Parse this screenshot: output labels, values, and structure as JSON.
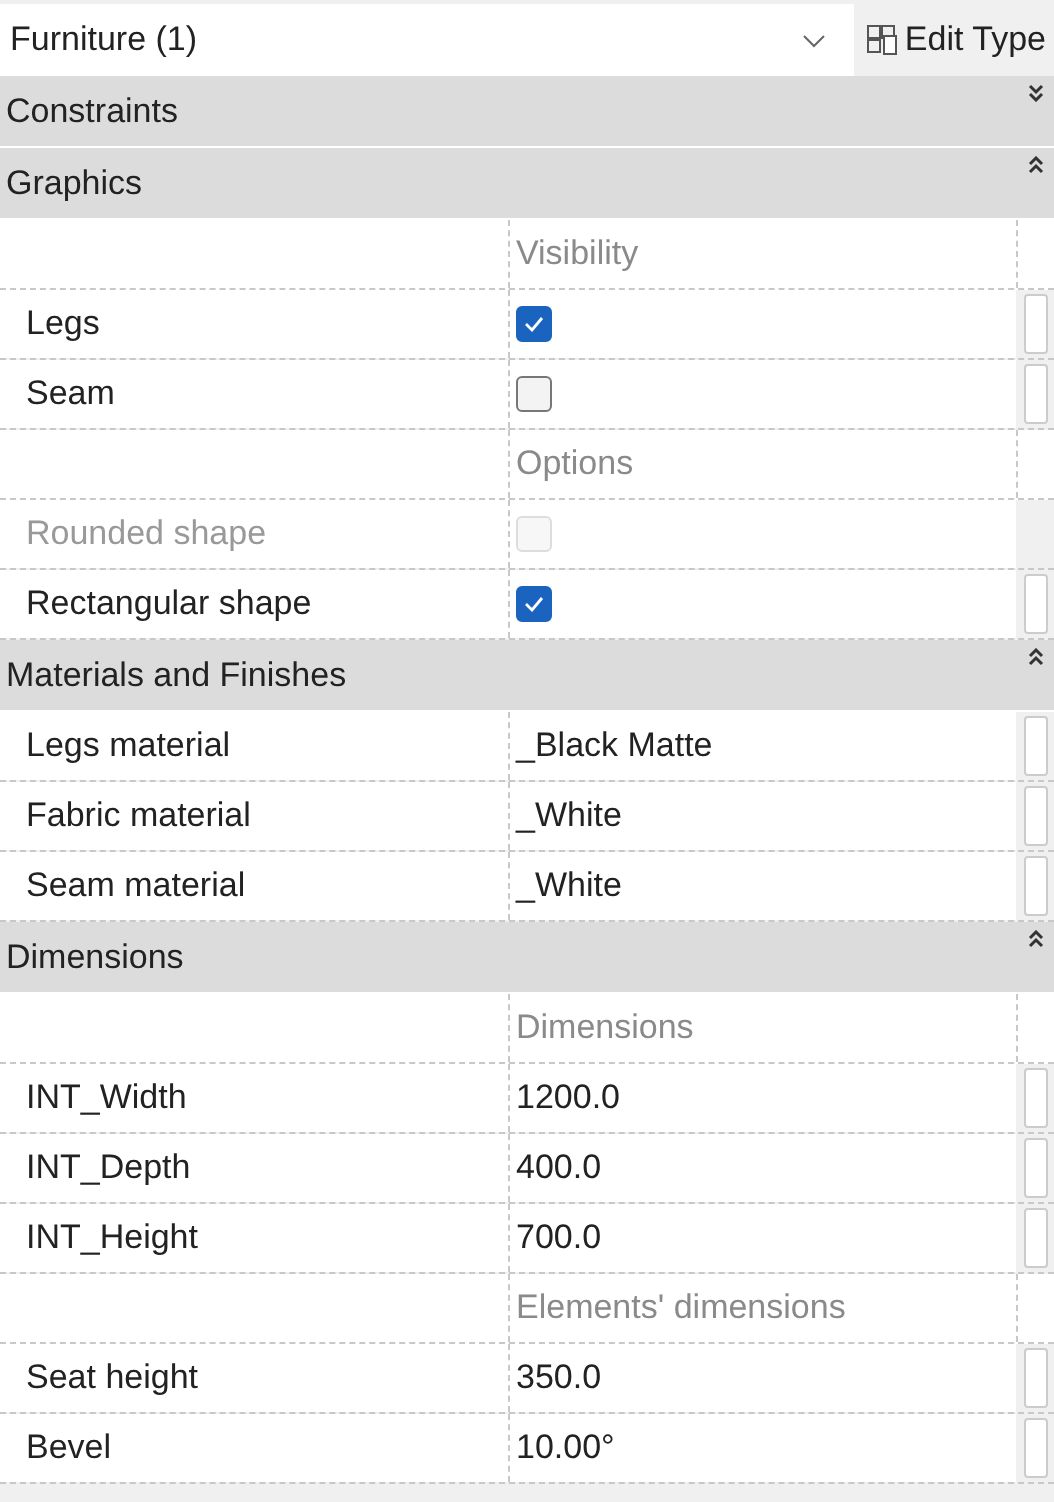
{
  "type_selector": {
    "value": "Furniture (1)"
  },
  "edit_type_button": {
    "label": "Edit Type"
  },
  "sections": [
    {
      "title": "Constraints",
      "expanded": false
    },
    {
      "title": "Graphics",
      "expanded": true,
      "rows": [
        {
          "kind": "group",
          "label": "Visibility"
        },
        {
          "kind": "check",
          "label": "Legs",
          "checked": true,
          "disabled": false
        },
        {
          "kind": "check",
          "label": "Seam",
          "checked": false,
          "disabled": false
        },
        {
          "kind": "group",
          "label": "Options"
        },
        {
          "kind": "check",
          "label": "Rounded shape",
          "checked": false,
          "disabled": true
        },
        {
          "kind": "check",
          "label": "Rectangular shape",
          "checked": true,
          "disabled": false
        }
      ]
    },
    {
      "title": "Materials and Finishes",
      "expanded": true,
      "rows": [
        {
          "kind": "text",
          "label": "Legs material",
          "value": "_Black Matte"
        },
        {
          "kind": "text",
          "label": "Fabric material",
          "value": "_White"
        },
        {
          "kind": "text",
          "label": "Seam material",
          "value": "_White"
        }
      ]
    },
    {
      "title": "Dimensions",
      "expanded": true,
      "rows": [
        {
          "kind": "group",
          "label": "Dimensions"
        },
        {
          "kind": "text",
          "label": "INT_Width",
          "value": "1200.0"
        },
        {
          "kind": "text",
          "label": "INT_Depth",
          "value": "400.0"
        },
        {
          "kind": "text",
          "label": "INT_Height",
          "value": "700.0"
        },
        {
          "kind": "group",
          "label": "Elements' dimensions"
        },
        {
          "kind": "text",
          "label": "Seat height",
          "value": "350.0"
        },
        {
          "kind": "text",
          "label": "Bevel",
          "value": "10.00°"
        }
      ]
    }
  ]
}
